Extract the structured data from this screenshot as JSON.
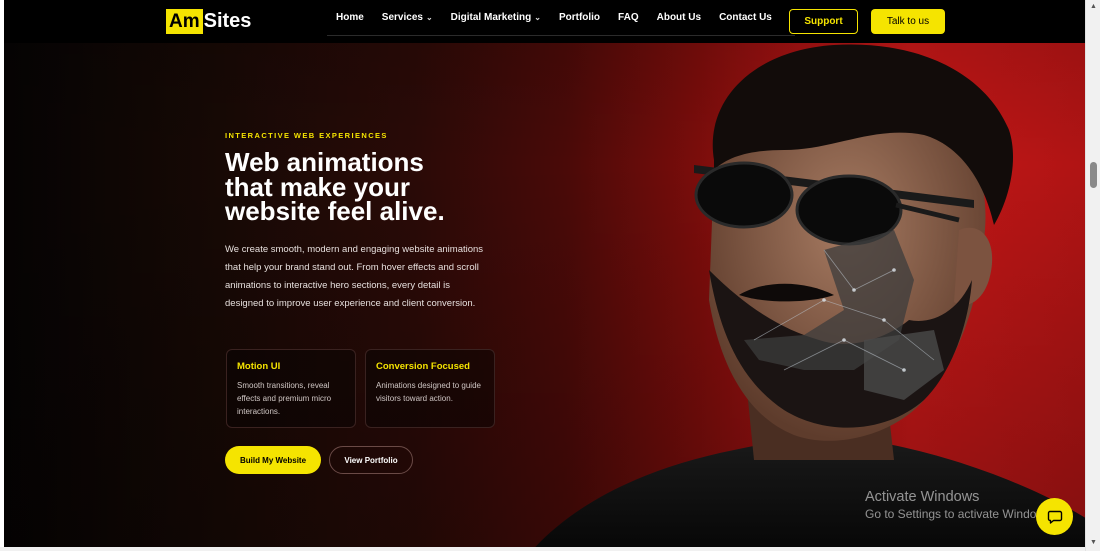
{
  "logo": {
    "part1": "Am",
    "part2": "Sites"
  },
  "nav": {
    "items": [
      {
        "label": "Home",
        "dropdown": false
      },
      {
        "label": "Services",
        "dropdown": true
      },
      {
        "label": "Digital Marketing",
        "dropdown": true
      },
      {
        "label": "Portfolio",
        "dropdown": false
      },
      {
        "label": "FAQ",
        "dropdown": false
      },
      {
        "label": "About Us",
        "dropdown": false
      },
      {
        "label": "Contact Us",
        "dropdown": false
      }
    ],
    "chevron": "⌄"
  },
  "header_buttons": {
    "support": "Support",
    "talk": "Talk to us"
  },
  "hero": {
    "eyebrow": "INTERACTIVE WEB EXPERIENCES",
    "headline_lines": [
      "Web animations",
      "that make your",
      "website feel alive."
    ],
    "description": "We create smooth, modern and engaging website animations that help your brand stand out. From hover effects and scroll animations to interactive hero sections, every detail is designed to improve user experience and client conversion.",
    "cards": [
      {
        "title": "Motion UI",
        "text": "Smooth transitions, reveal effects and premium micro interactions."
      },
      {
        "title": "Conversion Focused",
        "text": "Animations designed to guide visitors toward action."
      }
    ],
    "primary_button": "Build My Website",
    "secondary_button": "View Portfolio"
  },
  "watermark": {
    "line1": "Activate Windows",
    "line2": "Go to Settings to activate Windows."
  },
  "chat": {
    "icon": "chat-bubble-icon"
  },
  "colors": {
    "accent": "#f5e400",
    "header_bg": "#000000",
    "hero_red": "#c41717"
  }
}
